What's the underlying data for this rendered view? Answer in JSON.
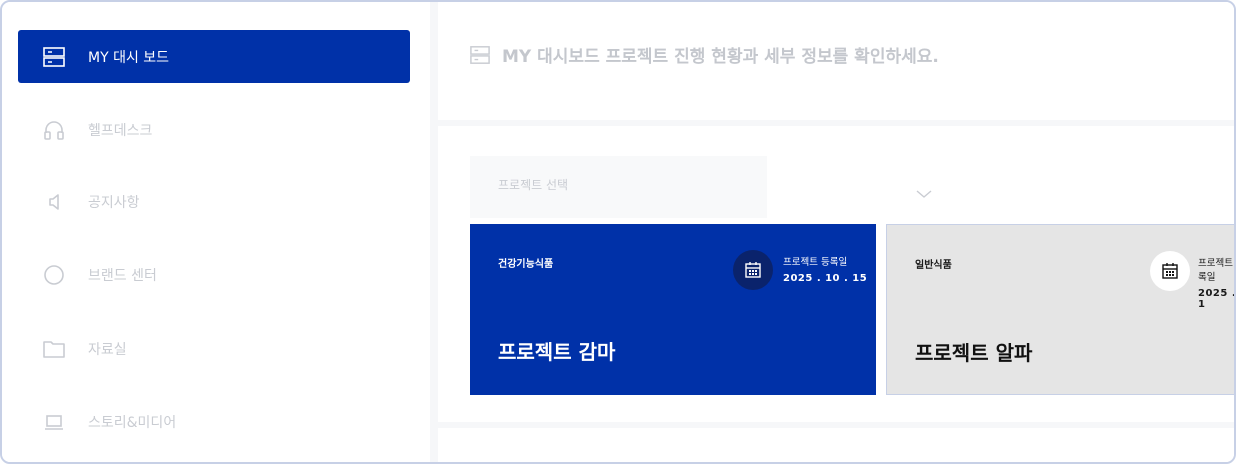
{
  "sidebar": {
    "items": [
      {
        "label": "MY 대시 보드",
        "icon": "dashboard-icon",
        "active": true
      },
      {
        "label": "헬프데스크",
        "icon": "headset-icon",
        "active": false
      },
      {
        "label": "공지사항",
        "icon": "megaphone-icon",
        "active": false
      },
      {
        "label": "브랜드 센터",
        "icon": "circle-icon",
        "active": false
      },
      {
        "label": "자료실",
        "icon": "folder-icon",
        "active": false
      },
      {
        "label": "스토리&미디어",
        "icon": "laptop-icon",
        "active": false
      }
    ]
  },
  "header": {
    "title": "MY 대시보드 프로젝트 진행 현황과 세부 정보를 확인하세요.",
    "icon": "dashboard-icon"
  },
  "project_select": {
    "placeholder": "프로젝트 선택"
  },
  "projects": [
    {
      "category": "건강기능식품",
      "reg_label": "프로젝트 등록일",
      "reg_date": "2025 . 10 . 15",
      "name": "프로젝트 감마"
    },
    {
      "category": "일반식품",
      "reg_label": "프로젝트 등록일",
      "reg_date": "2025 . 1",
      "name": "프로젝트 알파"
    }
  ],
  "colors": {
    "accent": "#0031a8",
    "accent_dark": "#0a236c",
    "muted_text": "#c9ccd2",
    "card_gray": "#e5e5e5",
    "border": "#c7d0e6"
  }
}
